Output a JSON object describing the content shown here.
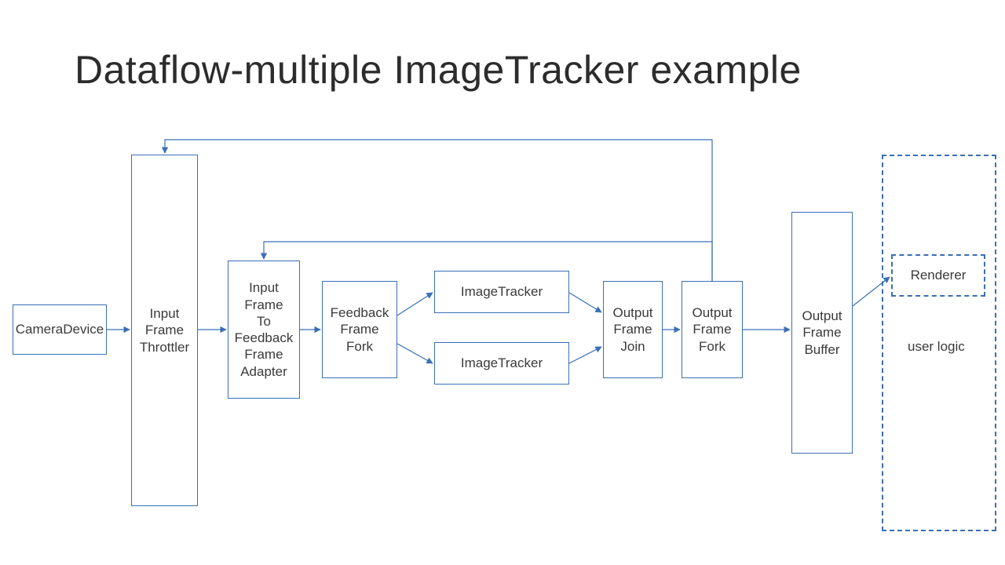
{
  "title": "Dataflow-multiple ImageTracker example",
  "nodes": {
    "camera": {
      "label": "CameraDevice"
    },
    "throttler": {
      "label": "Input\nFrame\nThrottler"
    },
    "adapter": {
      "label": "Input\nFrame\nTo\nFeedback\nFrame\nAdapter"
    },
    "feedbackFork": {
      "label": "Feedback\nFrame\nFork"
    },
    "tracker1": {
      "label": "ImageTracker"
    },
    "tracker2": {
      "label": "ImageTracker"
    },
    "join": {
      "label": "Output\nFrame\nJoin"
    },
    "outFork": {
      "label": "Output\nFrame\nFork"
    },
    "outBuffer": {
      "label": "Output\nFrame\nBuffer"
    },
    "renderer": {
      "label": "Renderer"
    },
    "userLogic": {
      "label": "user logic"
    }
  },
  "edges": [
    {
      "from": "camera",
      "to": "throttler"
    },
    {
      "from": "throttler",
      "to": "adapter"
    },
    {
      "from": "adapter",
      "to": "feedbackFork"
    },
    {
      "from": "feedbackFork",
      "to": "tracker1",
      "kind": "diverge-up"
    },
    {
      "from": "feedbackFork",
      "to": "tracker2",
      "kind": "diverge-down"
    },
    {
      "from": "tracker1",
      "to": "join",
      "kind": "converge-up"
    },
    {
      "from": "tracker2",
      "to": "join",
      "kind": "converge-down"
    },
    {
      "from": "join",
      "to": "outFork"
    },
    {
      "from": "outFork",
      "to": "outBuffer"
    },
    {
      "from": "outBuffer",
      "to": "renderer",
      "kind": "diag"
    },
    {
      "from": "outFork",
      "to": "throttler",
      "kind": "feedback-long"
    },
    {
      "from": "outFork",
      "to": "adapter",
      "kind": "feedback-short"
    }
  ]
}
